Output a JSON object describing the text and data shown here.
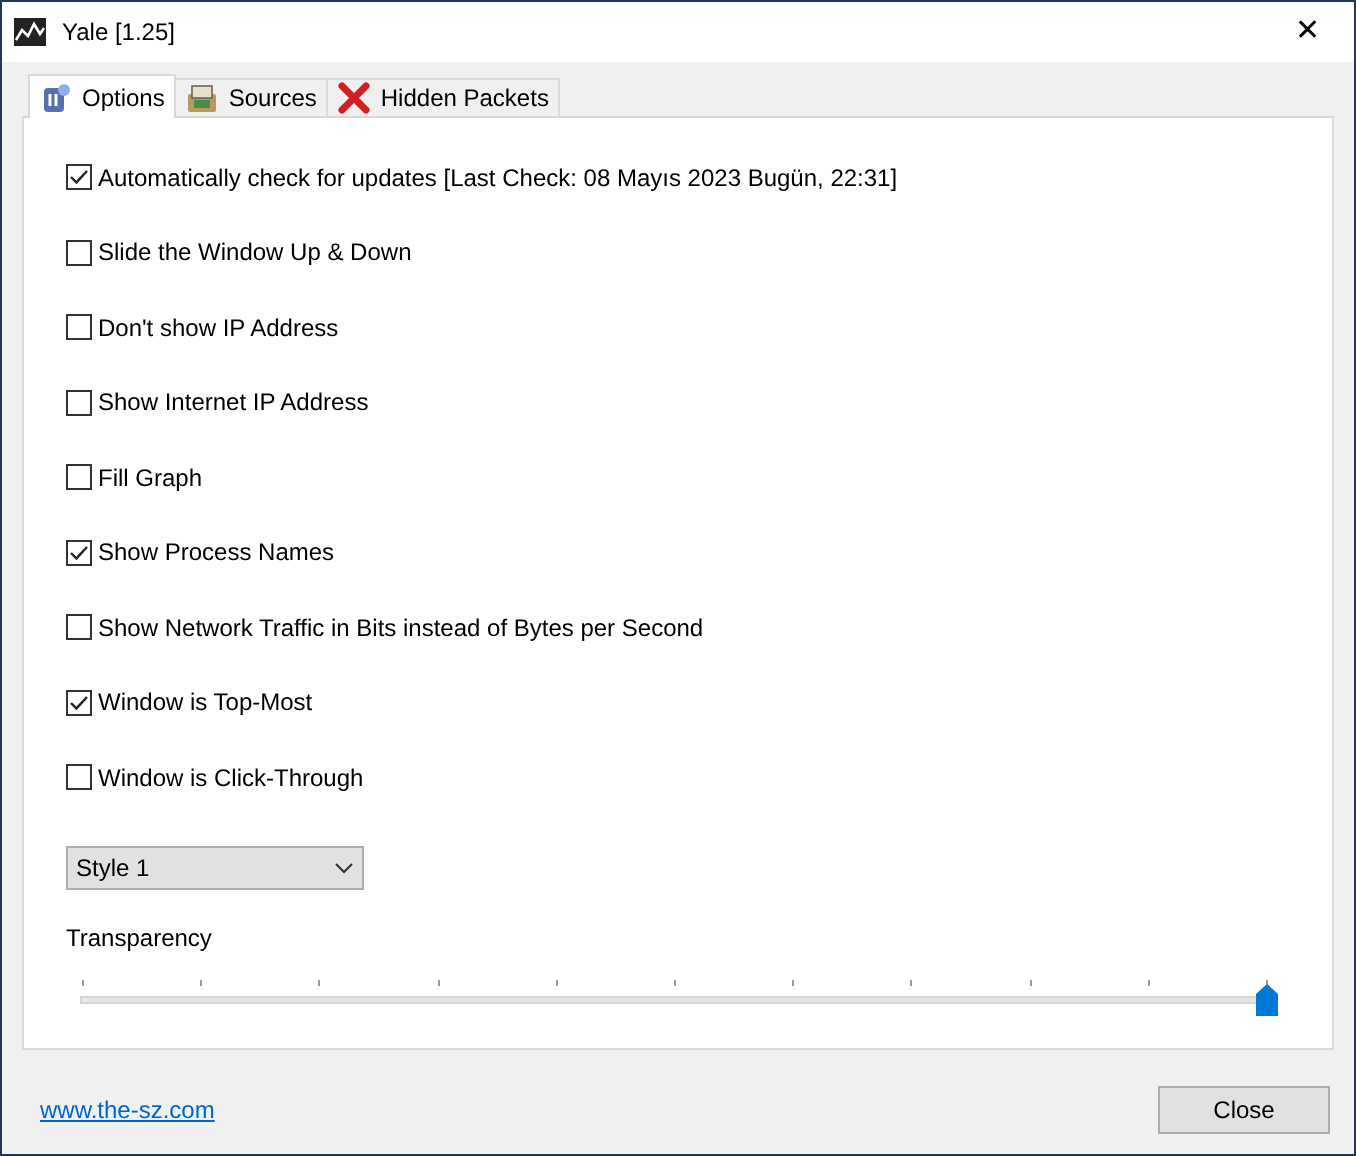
{
  "window": {
    "title": "Yale [1.25]",
    "close": "✕"
  },
  "tabs": [
    {
      "label": "Options",
      "selected": true,
      "kind": "options"
    },
    {
      "label": "Sources",
      "selected": false,
      "kind": "sources"
    },
    {
      "label": "Hidden Packets",
      "selected": false,
      "kind": "hidden"
    }
  ],
  "options": [
    {
      "label": "Automatically check for updates [Last Check: 08 Mayıs 2023 Bugün, 22:31]",
      "checked": true
    },
    {
      "label": "Slide the Window Up & Down",
      "checked": false
    },
    {
      "label": "Don't show IP Address",
      "checked": false
    },
    {
      "label": "Show Internet IP Address",
      "checked": false
    },
    {
      "label": "Fill Graph",
      "checked": false
    },
    {
      "label": "Show Process Names",
      "checked": true
    },
    {
      "label": "Show Network Traffic in Bits instead of Bytes per Second",
      "checked": false
    },
    {
      "label": "Window is Top-Most",
      "checked": true
    },
    {
      "label": "Window is Click-Through",
      "checked": false
    }
  ],
  "style_dropdown": {
    "value": "Style 1"
  },
  "transparency": {
    "label": "Transparency",
    "level": 1.0
  },
  "footer": {
    "link": "www.the-sz.com",
    "button": "Close"
  }
}
